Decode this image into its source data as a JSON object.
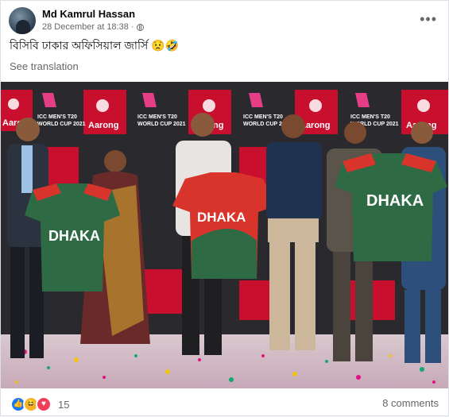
{
  "post": {
    "author": "Md Kamrul Hassan",
    "date": "28 December at 18:38",
    "date_sep": "·",
    "caption": "বিসিবি ঢাকার অফিসিয়াল জার্সি 😟🤣",
    "see_translation": "See translation",
    "more_label": "•••"
  },
  "photo": {
    "backdrop_texts": [
      "Aarong",
      "ICC MEN'S T20 WORLD CUP 2021",
      "আড়ং"
    ],
    "jersey_text": "DHAKA",
    "colors": {
      "backdrop": "#1a1a1a",
      "aarong_red": "#c8102e",
      "jersey_green": "#2e6b45",
      "jersey_red": "#d8342c"
    }
  },
  "footer": {
    "reaction_count": "15",
    "comments": "8 comments",
    "reaction_icons": [
      "like-icon",
      "haha-icon",
      "love-icon"
    ]
  }
}
